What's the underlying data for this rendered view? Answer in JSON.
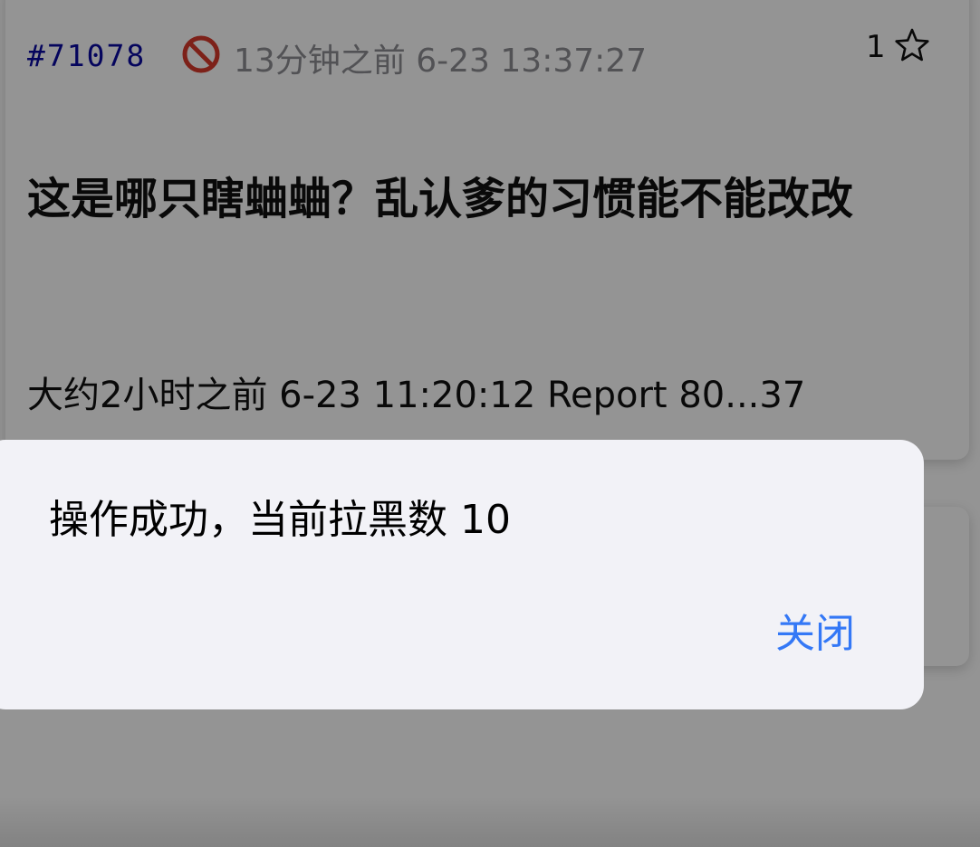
{
  "post": {
    "id": "#71078",
    "time": "13分钟之前 6-23 13:37:27",
    "likes": "1",
    "title": "这是哪只瞎蛐蛐？乱认爹的习惯能不能改改",
    "meta": "大约2小时之前 6-23 11:20:12 Report 80...37",
    "icons": [
      "ban-icon",
      "star-outline-icon"
    ]
  },
  "alert": {
    "message": "操作成功，当前拉黑数 10",
    "close_label": "关闭",
    "accent_color": "#3478f6"
  }
}
